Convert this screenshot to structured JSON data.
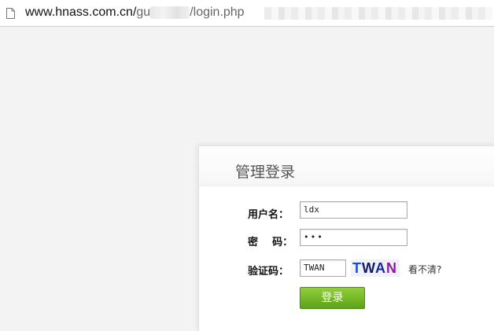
{
  "browser": {
    "url_host": "www.hnass.com.cn/",
    "url_fragment_1": "gu",
    "url_fragment_2": "/login.php"
  },
  "login": {
    "title": "管理登录",
    "username_label": "用户名：",
    "username_value": "ldx",
    "password_label": "密    码：",
    "password_value": "•••",
    "captcha_label": "验证码：",
    "captcha_value": "TWAN",
    "captcha_chars": [
      "T",
      "W",
      "A",
      "N"
    ],
    "refresh_label": "看不清?",
    "submit_label": "登录"
  },
  "colors": {
    "button_top": "#8fd13a",
    "button_bottom": "#5fa11a",
    "page_background": "#f3f3f3"
  }
}
